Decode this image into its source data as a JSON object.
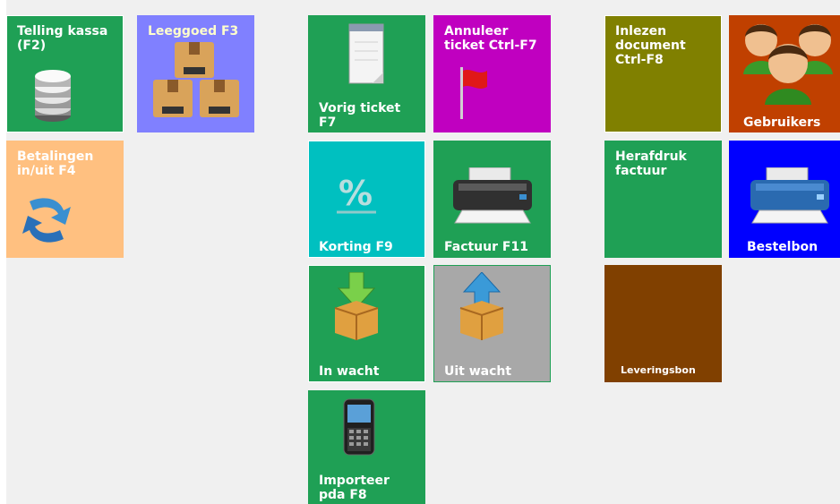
{
  "tiles": {
    "telling_kassa": {
      "label": "Telling kassa (F2)",
      "icon": "database-icon",
      "color": "#1fa055"
    },
    "leeggoed": {
      "label": "Leeggoed F3",
      "icon": "boxes-icon",
      "color": "#8080ff"
    },
    "betalingen": {
      "label": "Betalingen in/uit F4",
      "icon": "exchange-arrows-icon",
      "color": "#ffc080"
    },
    "vorig_ticket": {
      "label": "Vorig ticket F7",
      "icon": "notepad-icon",
      "color": "#1fa055"
    },
    "annuleer_ticket": {
      "label": "Annuleer ticket Ctrl-F7",
      "icon": "red-flag-icon",
      "color": "#c000c0"
    },
    "inlezen_document": {
      "label": "Inlezen document Ctrl-F8",
      "icon": "",
      "color": "#808000"
    },
    "gebruikers": {
      "label": "Gebruikers",
      "icon": "users-icon",
      "color": "#c04000"
    },
    "korting": {
      "label": "Korting F9",
      "icon": "percent-icon",
      "color": "#00c0c0"
    },
    "factuur": {
      "label": "Factuur F11",
      "icon": "printer-icon",
      "color": "#1fa055"
    },
    "herafdruk_factuur": {
      "label": "Herafdruk factuur",
      "icon": "",
      "color": "#1fa055"
    },
    "bestelbon": {
      "label": "Bestelbon",
      "icon": "printer-icon",
      "color": "#0000ff"
    },
    "in_wacht": {
      "label": "In wacht",
      "icon": "box-down-arrow-icon",
      "color": "#1fa055"
    },
    "uit_wacht": {
      "label": "Uit wacht",
      "icon": "box-up-arrow-icon",
      "color": "#a8a8a8"
    },
    "leveringsbon": {
      "label": "Leveringsbon",
      "icon": "",
      "color": "#804000"
    },
    "importeer_pda": {
      "label": "Importeer pda F8",
      "icon": "smartphone-icon",
      "color": "#1fa055"
    }
  }
}
